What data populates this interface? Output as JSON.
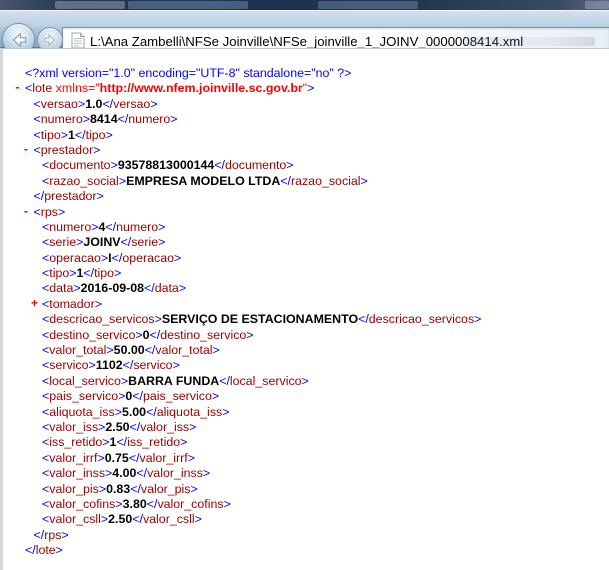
{
  "browser": {
    "address": "L:\\Ana Zambelli\\NFSe Joinville\\NFSe_joinville_1_JOINV_0000008414.xml",
    "back_icon": "arrow-left",
    "forward_icon": "arrow-right",
    "file_icon": "document"
  },
  "colors": {
    "markup": "#0000ff",
    "tag": "#990000",
    "text": "#000000",
    "namespace": "#ff0000",
    "marker": "#ff0000"
  },
  "xml": {
    "lines": [
      {
        "type": "pi",
        "indent": 0,
        "text": "<?xml version=\"1.0\" encoding=\"UTF-8\" standalone=\"no\" ?>"
      },
      {
        "type": "open",
        "indent": 0,
        "marker": "-",
        "name": "lote",
        "attr": {
          "name": "xmlns",
          "value": "http://www.nfem.joinville.sc.gov.br"
        }
      },
      {
        "type": "elem",
        "indent": 1,
        "name": "versao",
        "value": "1.0"
      },
      {
        "type": "elem",
        "indent": 1,
        "name": "numero",
        "value": "8414"
      },
      {
        "type": "elem",
        "indent": 1,
        "name": "tipo",
        "value": "1"
      },
      {
        "type": "open",
        "indent": 1,
        "marker": "-",
        "name": "prestador"
      },
      {
        "type": "elem",
        "indent": 2,
        "name": "documento",
        "value": "93578813000144"
      },
      {
        "type": "elem",
        "indent": 2,
        "name": "razao_social",
        "value": "EMPRESA MODELO LTDA"
      },
      {
        "type": "close",
        "indent": 1,
        "name": "prestador"
      },
      {
        "type": "open",
        "indent": 1,
        "marker": "-",
        "name": "rps"
      },
      {
        "type": "elem",
        "indent": 2,
        "name": "numero",
        "value": "4"
      },
      {
        "type": "elem",
        "indent": 2,
        "name": "serie",
        "value": "JOINV"
      },
      {
        "type": "elem",
        "indent": 2,
        "name": "operacao",
        "value": "I"
      },
      {
        "type": "elem",
        "indent": 2,
        "name": "tipo",
        "value": "1"
      },
      {
        "type": "elem",
        "indent": 2,
        "name": "data",
        "value": "2016-09-08"
      },
      {
        "type": "open",
        "indent": 2,
        "marker": "+",
        "name": "tomador"
      },
      {
        "type": "elem",
        "indent": 2,
        "name": "descricao_servicos",
        "value": "SERVIÇO DE ESTACIONAMENTO"
      },
      {
        "type": "elem",
        "indent": 2,
        "name": "destino_servico",
        "value": "0"
      },
      {
        "type": "elem",
        "indent": 2,
        "name": "valor_total",
        "value": "50.00"
      },
      {
        "type": "elem",
        "indent": 2,
        "name": "servico",
        "value": "1102"
      },
      {
        "type": "elem",
        "indent": 2,
        "name": "local_servico",
        "value": "BARRA FUNDA"
      },
      {
        "type": "elem",
        "indent": 2,
        "name": "pais_servico",
        "value": "0"
      },
      {
        "type": "elem",
        "indent": 2,
        "name": "aliquota_iss",
        "value": "5.00"
      },
      {
        "type": "elem",
        "indent": 2,
        "name": "valor_iss",
        "value": "2.50"
      },
      {
        "type": "elem",
        "indent": 2,
        "name": "iss_retido",
        "value": "1"
      },
      {
        "type": "elem",
        "indent": 2,
        "name": "valor_irrf",
        "value": "0.75"
      },
      {
        "type": "elem",
        "indent": 2,
        "name": "valor_inss",
        "value": "4.00"
      },
      {
        "type": "elem",
        "indent": 2,
        "name": "valor_pis",
        "value": "0.83"
      },
      {
        "type": "elem",
        "indent": 2,
        "name": "valor_cofins",
        "value": "3.80"
      },
      {
        "type": "elem",
        "indent": 2,
        "name": "valor_csll",
        "value": "2.50"
      },
      {
        "type": "close",
        "indent": 1,
        "name": "rps"
      },
      {
        "type": "close",
        "indent": 0,
        "name": "lote"
      }
    ]
  }
}
